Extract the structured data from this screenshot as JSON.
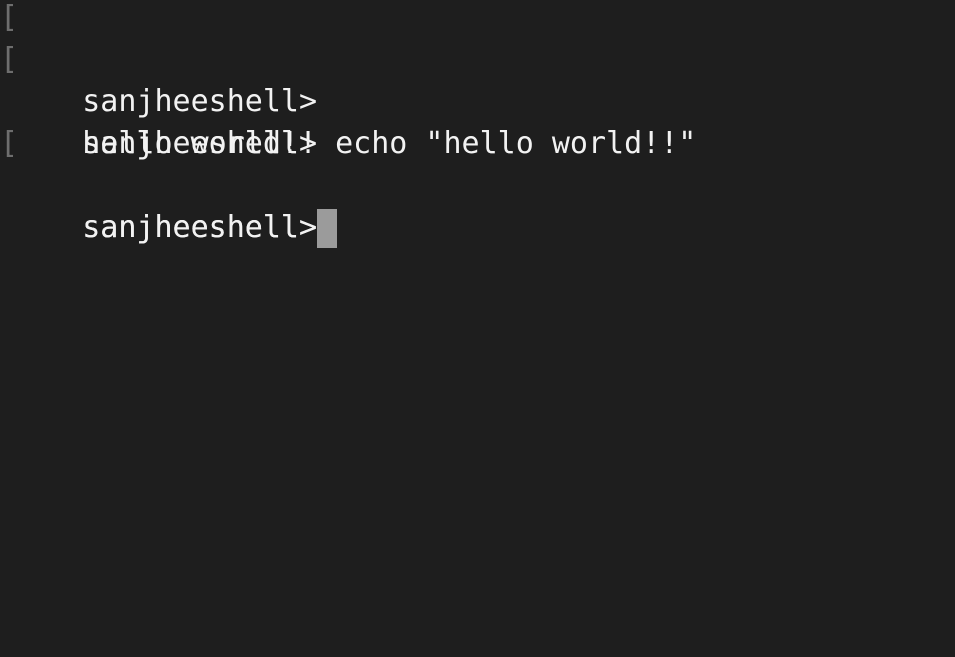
{
  "terminal": {
    "background": "#1e1e1e",
    "foreground": "#f2f2f2",
    "cursor_color": "#9b9b9b",
    "marker_glyph": "[",
    "lines": [
      {
        "text": "sanjheeshell>",
        "marked": true
      },
      {
        "text": "sanjheeshell> echo \"hello world!!\"",
        "marked": true
      },
      {
        "text": "hello world!!",
        "marked": false
      },
      {
        "text": "sanjheeshell>",
        "marked": true
      },
      {
        "text": "sanjheeshell>",
        "marked": false
      }
    ]
  }
}
